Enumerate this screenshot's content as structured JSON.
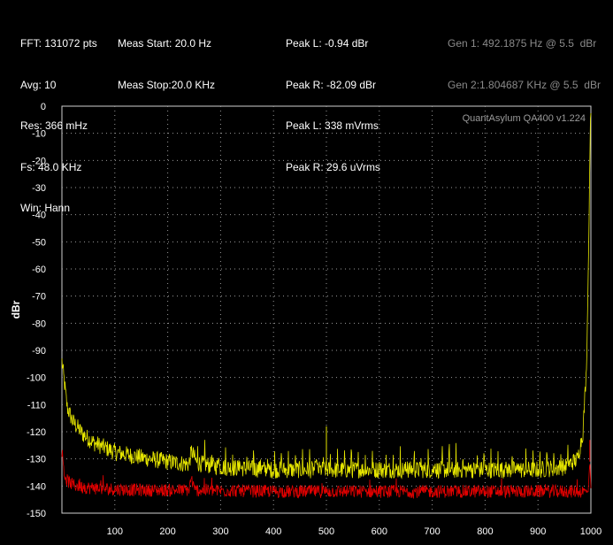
{
  "info": {
    "col1": [
      "FFT: 131072 pts",
      "Avg: 10",
      "Res: 366 mHz",
      "Fs: 48.0 KHz",
      "Win: Hann"
    ],
    "col2": [
      "Meas Start: 20.0 Hz",
      "Meas Stop:20.0 KHz"
    ],
    "col3": [
      "Peak L: -0.94 dBr",
      "Peak R: -82.09 dBr",
      "Peak L: 338 mVrms",
      "Peak R: 29.6 uVrms"
    ],
    "col4": [
      "Gen 1: 492.1875 Hz @ 5.5  dBr",
      "Gen 2:1.804687 KHz @ 5.5  dBr"
    ]
  },
  "chart_data": {
    "type": "line",
    "title": "",
    "watermark": "QuantAsylum QA400 v1.224",
    "xlabel": "",
    "ylabel": "dBr",
    "xlim": [
      0,
      1000
    ],
    "ylim": [
      -150,
      0
    ],
    "x_ticks": [
      "100",
      "200",
      "300",
      "400",
      "500",
      "600",
      "700",
      "800",
      "900",
      "1000"
    ],
    "y_ticks": [
      "0",
      "-10",
      "-20",
      "-30",
      "-40",
      "-50",
      "-60",
      "-70",
      "-80",
      "-90",
      "-100",
      "-110",
      "-120",
      "-130",
      "-140",
      "-150"
    ],
    "grid": true,
    "series": [
      {
        "color": "#e6e600",
        "x": [
          0,
          10,
          20,
          40,
          60,
          100,
          150,
          200,
          240,
          245,
          255,
          300,
          400,
          500,
          600,
          700,
          800,
          900,
          950,
          975,
          985,
          992,
          996,
          999,
          1000
        ],
        "values": [
          -94,
          -111,
          -116,
          -121,
          -124,
          -127.5,
          -129.5,
          -131,
          -132,
          -127,
          -131.5,
          -133,
          -134,
          -134,
          -134,
          -134,
          -134,
          -134,
          -133,
          -130,
          -120,
          -95,
          -50,
          -5,
          -2
        ],
        "spikes": [
          {
            "x": 245,
            "y": -126
          },
          {
            "x": 500,
            "y": -118
          }
        ]
      },
      {
        "color": "#e00000",
        "x": [
          0,
          5,
          10,
          20,
          40,
          80,
          150,
          240,
          245,
          250,
          400,
          600,
          800,
          995,
          998,
          1000
        ],
        "values": [
          -127,
          -136,
          -138,
          -139.5,
          -140.5,
          -141,
          -141.5,
          -141.5,
          -137,
          -141.5,
          -142,
          -142,
          -142,
          -142,
          -131,
          -141
        ],
        "spikes": [
          {
            "x": 998,
            "y": -123
          }
        ]
      }
    ]
  }
}
